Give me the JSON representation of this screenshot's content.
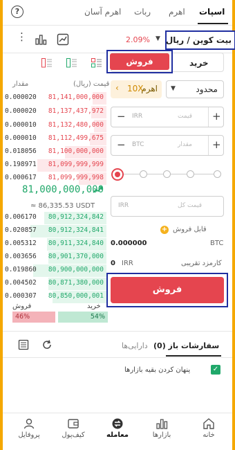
{
  "tabs": [
    {
      "label": "اسپات",
      "active": true
    },
    {
      "label": "اهرم",
      "active": false
    },
    {
      "label": "ربات",
      "active": false
    },
    {
      "label": "اهرم آسان",
      "active": false
    }
  ],
  "pair": {
    "name": "بیت کوین / ریال",
    "change": "2.09%"
  },
  "trade": {
    "buy_tab": "خرید",
    "sell_tab": "فروش",
    "order_type": "محدود",
    "leverage_label": "اهرم",
    "leverage_value": "10X",
    "price_placeholder": "قیمت",
    "price_unit": "IRR",
    "amount_placeholder": "مقدار",
    "amount_unit": "BTC",
    "total_placeholder": "قیمت کل",
    "total_unit": "IRR",
    "sellable_label": "قابل فروش",
    "sellable_value": "0.000000",
    "sellable_unit": "BTC",
    "fee_label": "کارمزد تقریبی",
    "fee_unit": "IRR",
    "fee_value": "0",
    "submit_label": "فروش",
    "slider_percent": 0
  },
  "orderbook": {
    "price_header": "قیمت (ریال)",
    "amount_header": "مقدار",
    "asks": [
      {
        "price": "81,141,000,000",
        "amount": "0.000020"
      },
      {
        "price": "81,137,437,972",
        "amount": "0.000020"
      },
      {
        "price": "81,132,480,000",
        "amount": "0.000010"
      },
      {
        "price": "81,112,499,675",
        "amount": "0.000010"
      },
      {
        "price": "81,100,000,000",
        "amount": "0.018056"
      },
      {
        "price": "81,099,999,999",
        "amount": "0.198971"
      },
      {
        "price": "81,099,999,998",
        "amount": "0.000617"
      }
    ],
    "last_price": "81,000,000,000",
    "usdt_price": "≈ 86,335.53 USDT",
    "bids": [
      {
        "price": "80,912,324,842",
        "amount": "0.006170"
      },
      {
        "price": "80,912,324,841",
        "amount": "0.020857"
      },
      {
        "price": "80,911,324,840",
        "amount": "0.005312"
      },
      {
        "price": "80,901,370,000",
        "amount": "0.003656"
      },
      {
        "price": "80,900,000,000",
        "amount": "0.019860"
      },
      {
        "price": "80,871,380,000",
        "amount": "0.004502"
      },
      {
        "price": "80,850,000,001",
        "amount": "0.000307"
      }
    ],
    "sell_label": "فروش",
    "buy_label": "خرید",
    "sell_percent": "46%",
    "buy_percent": "54%"
  },
  "orders": {
    "open_label": "سفارشات باز (0)",
    "assets_label": "دارایی‌ها",
    "hide_others_label": "پنهان کردن بقیه بازارها"
  },
  "nav": [
    {
      "label": "خانه",
      "icon": "home-icon"
    },
    {
      "label": "بازارها",
      "icon": "markets-icon"
    },
    {
      "label": "معامله",
      "icon": "trade-icon",
      "active": true
    },
    {
      "label": "کیف‌پول",
      "icon": "wallet-icon"
    },
    {
      "label": "پروفایل",
      "icon": "profile-icon"
    }
  ],
  "colors": {
    "accent": "#e5454f",
    "buy": "#20a86a",
    "frame": "#f5a800",
    "highlight": "#1f2ea0"
  }
}
